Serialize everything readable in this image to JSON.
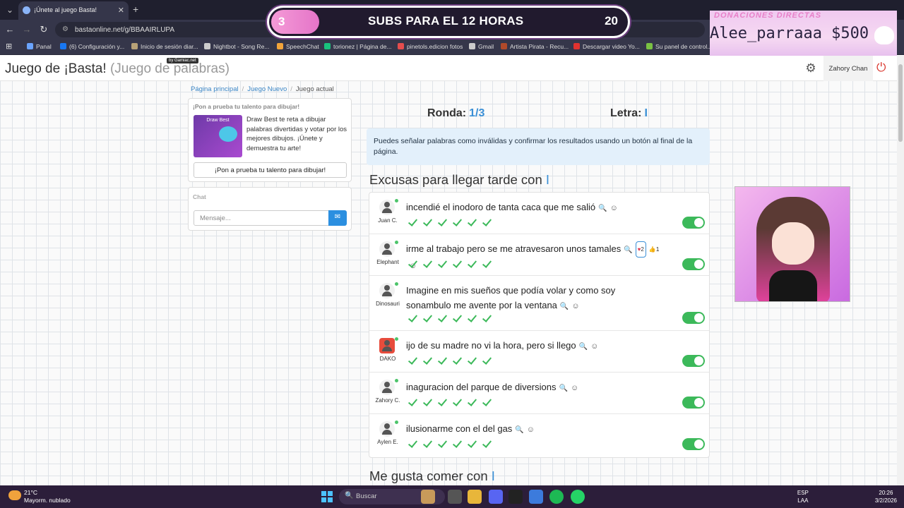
{
  "browser": {
    "tab_title": "¡Únete al juego Basta!",
    "url": "bastaonline.net/g/BBAAIRLUPA",
    "bookmarks": [
      {
        "label": "Panal",
        "color": "#6aa4ff"
      },
      {
        "label": "(6) Configuración y...",
        "color": "#1877f2"
      },
      {
        "label": "Inicio de sesión diar...",
        "color": "#b7a177"
      },
      {
        "label": "Nightbot - Song Re...",
        "color": "#cccccc"
      },
      {
        "label": "SpeechChat",
        "color": "#f2a43a"
      },
      {
        "label": "torionez | Página de...",
        "color": "#19c37d"
      },
      {
        "label": "pinetols.edicion fotos",
        "color": "#e44d4d"
      },
      {
        "label": "Gmail",
        "color": "#cccccc"
      },
      {
        "label": "Artista Pirata - Recu...",
        "color": "#b04a2a"
      },
      {
        "label": "Descargar video Yo...",
        "color": "#e0322f"
      },
      {
        "label": "Su panel de control...",
        "color": "#7ac143"
      }
    ]
  },
  "overlay": {
    "subs_count": "3",
    "subs_text": "SUBS PARA EL 12 HORAS",
    "subs_goal": "20",
    "donations_title": "DONACIONES DIRECTAS",
    "donation_line": "Alee_parraaa $500"
  },
  "header": {
    "brand": "Juego de ¡Basta!",
    "brand_sub": "(Juego de palabras)",
    "badge": "by Gamiac.net",
    "user": "Zahory Chan"
  },
  "breadcrumbs": [
    "Página principal",
    "Juego Nuevo",
    "Juego actual"
  ],
  "promo": {
    "heading": "¡Pon a prueba tu talento para dibujar!",
    "image_title": "Draw Best",
    "text": "Draw Best te reta a dibujar palabras divertidas y votar por los mejores dibujos. ¡Únete y demuestra tu arte!",
    "button": "¡Pon a prueba tu talento para dibujar!"
  },
  "chat": {
    "heading": "Chat",
    "placeholder": "Mensaje..."
  },
  "game": {
    "round_label": "Ronda:",
    "round_value": "1/3",
    "letter_label": "Letra:",
    "letter_value": "I",
    "info": "Puedes señalar palabras como inválidas y confirmar los resultados usando un botón al final de la página.",
    "category1_prefix": "Excusas para llegar tarde con",
    "category2_prefix": "Me gusta comer con",
    "answers": [
      {
        "user": "Juan C.",
        "text": "incendié el inodoro de tanta caca que me salió",
        "valid": true
      },
      {
        "user": "Elephant",
        "text": "irme al trabajo pero se me atravesaron unos tamales",
        "valid": true,
        "hearts": "2",
        "likes": "1"
      },
      {
        "user": "Dinosauri",
        "text": "Imagine en mis sueños que podía volar y como soy sonambulo me avente por la ventana",
        "valid": true
      },
      {
        "user": "DAKO",
        "text": "ijo de su madre no vi la hora, pero si llego",
        "valid": true
      },
      {
        "user": "Zahory C.",
        "text": "inaguracion del parque de diversions",
        "valid": true
      },
      {
        "user": "Aylen E.",
        "text": "ilusionarme con el del gas",
        "valid": true
      }
    ]
  },
  "taskbar": {
    "temp": "21°C",
    "weather": "Mayorm. nublado",
    "search": "Buscar",
    "lang1": "ESP",
    "lang2": "LAA",
    "time": "20:26",
    "date": "3/2/2026"
  }
}
